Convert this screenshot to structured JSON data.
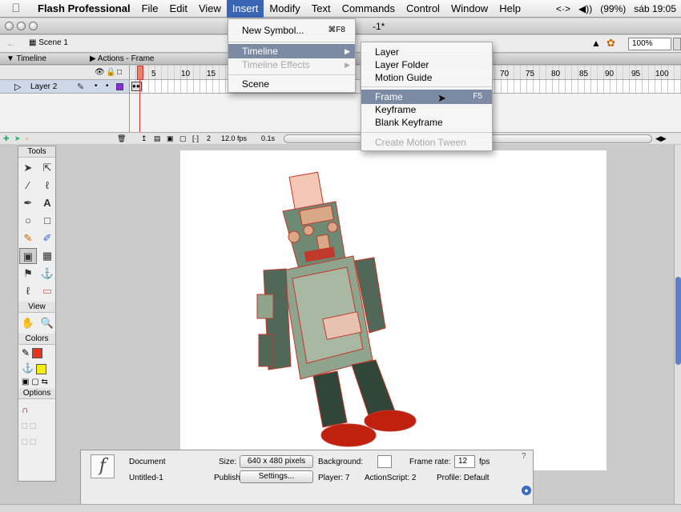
{
  "menubar": {
    "app_name": "Flash Professional",
    "items": [
      "File",
      "Edit",
      "View",
      "Insert",
      "Modify",
      "Text",
      "Commands",
      "Control",
      "Window",
      "Help"
    ],
    "status": {
      "extras": "<·>",
      "volume": "◀))",
      "battery": "(99%)",
      "clock": "sáb 19:05"
    }
  },
  "window": {
    "title_fragment": "-1*"
  },
  "scenebar": {
    "scene": "Scene 1",
    "zoom": "100%"
  },
  "panels": {
    "timeline": "Timeline",
    "actions": "Actions - Frame"
  },
  "timeline": {
    "ruler_labels": [
      "1",
      "5",
      "10",
      "15",
      "70",
      "75",
      "80",
      "85",
      "90",
      "95",
      "100"
    ],
    "layer_name": "Layer 2",
    "current_frame": "2",
    "frame_rate": "12.0 fps",
    "elapsed": "0.1s"
  },
  "insert_menu": {
    "new_symbol": "New Symbol...",
    "new_symbol_shortcut": "⌘F8",
    "timeline": "Timeline",
    "timeline_effects": "Timeline Effects",
    "scene": "Scene"
  },
  "timeline_submenu": {
    "layer": "Layer",
    "layer_folder": "Layer Folder",
    "motion_guide": "Motion Guide",
    "frame": "Frame",
    "frame_shortcut": "F5",
    "keyframe": "Keyframe",
    "blank_keyframe": "Blank Keyframe",
    "create_motion_tween": "Create Motion Tween"
  },
  "tools": {
    "title": "Tools",
    "view": "View",
    "colors": "Colors",
    "options": "Options"
  },
  "colors": {
    "stroke": "#e8321e",
    "fill": "#f5ea14",
    "menu_highlight": "#3c64b4",
    "submenu_highlight": "#7d8aa3"
  },
  "properties": {
    "type": "Document",
    "doc_name": "Untitled-1",
    "size_label": "Size:",
    "size_value": "640 x 480 pixels",
    "background_label": "Background:",
    "frame_rate_label": "Frame rate:",
    "frame_rate_value": "12",
    "fps_unit": "fps",
    "publish_label": "Publish:",
    "settings_button": "Settings...",
    "player": "Player: 7",
    "actionscript": "ActionScript: 2",
    "profile": "Profile: Default"
  }
}
